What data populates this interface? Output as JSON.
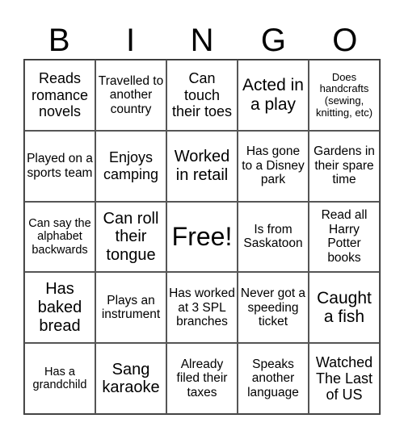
{
  "header": [
    "B",
    "I",
    "N",
    "G",
    "O"
  ],
  "cells": [
    [
      "Reads romance novels",
      "Travelled to another country",
      "Can touch their toes",
      "Acted in a play",
      "Does handcrafts (sewing, knitting, etc)"
    ],
    [
      "Played on a sports team",
      "Enjoys camping",
      "Worked in retail",
      "Has gone to a Disney park",
      "Gardens in their spare time"
    ],
    [
      "Can say the alphabet backwards",
      "Can roll their tongue",
      "Free!",
      "Is from Saskatoon",
      "Read all Harry Potter books"
    ],
    [
      "Has baked bread",
      "Plays an instrument",
      "Has worked at 3 SPL branches",
      "Never got a speeding ticket",
      "Caught a fish"
    ],
    [
      "Has a grandchild",
      "Sang karaoke",
      "Already filed their taxes",
      "Speaks another language",
      "Watched The Last of US"
    ]
  ]
}
